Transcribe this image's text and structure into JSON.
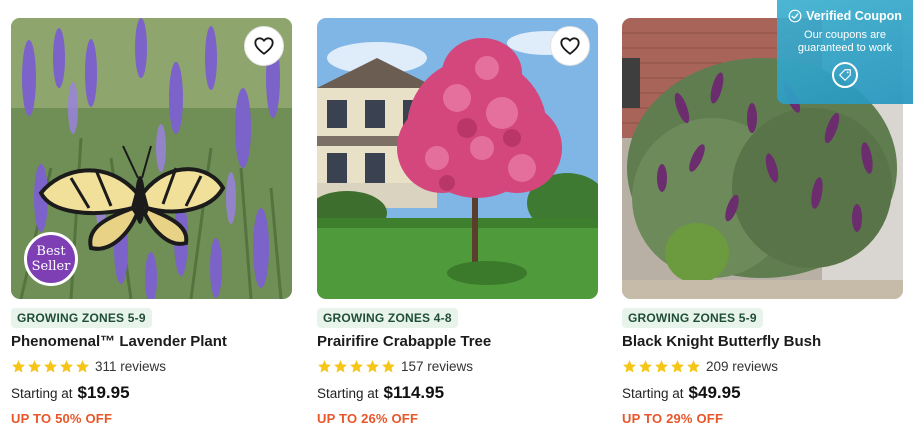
{
  "products": [
    {
      "zone": "GROWING ZONES 5-9",
      "name": "Phenomenal™ Lavender Plant",
      "rating_stars": 5,
      "reviews": "311 reviews",
      "price_prefix": "Starting at",
      "price": "$19.95",
      "discount": "UP TO 50% OFF",
      "badge_line1": "Best",
      "badge_line2": "Seller"
    },
    {
      "zone": "GROWING ZONES 4-8",
      "name": "Prairifire Crabapple Tree",
      "rating_stars": 5,
      "reviews": "157 reviews",
      "price_prefix": "Starting at",
      "price": "$114.95",
      "discount": "UP TO 26% OFF"
    },
    {
      "zone": "GROWING ZONES 5-9",
      "name": "Black Knight Butterfly Bush",
      "rating_stars": 5,
      "reviews": "209 reviews",
      "price_prefix": "Starting at",
      "price": "$49.95",
      "discount": "UP TO 29% OFF"
    }
  ],
  "coupon": {
    "title": "Verified Coupon",
    "line1": "Our coupons are",
    "line2": "guaranteed to work"
  },
  "colors": {
    "zone_bg": "#e7f3eb",
    "zone_text": "#1f4e35",
    "star": "#f5c518",
    "discount": "#e8562a",
    "coupon_bg": "#2fa3c7",
    "badge": "#7d3fb3"
  },
  "icons": {
    "favorite": "heart-outline-icon",
    "star": "star-icon",
    "verified": "check-circle-icon",
    "coupon": "tag-icon"
  }
}
